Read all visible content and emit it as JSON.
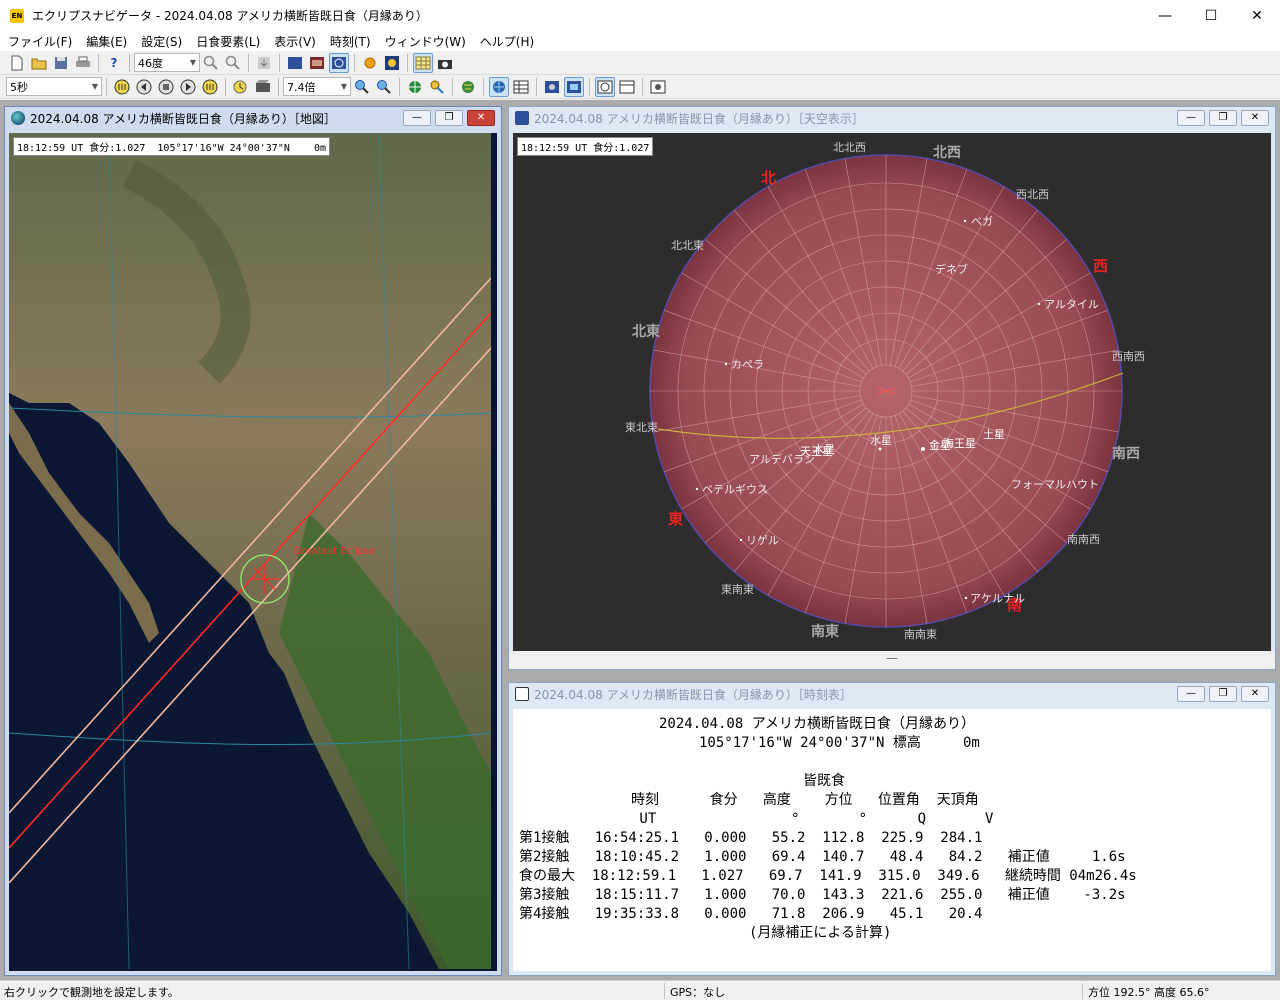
{
  "app": {
    "title": "エクリプスナビゲータ - 2024.04.08 アメリカ横断皆既日食（月縁あり）",
    "icon_label": "EN",
    "window_buttons": {
      "minimize": "—",
      "maximize": "☐",
      "close": "✕"
    }
  },
  "menu": [
    "ファイル(F)",
    "編集(E)",
    "設定(S)",
    "日食要素(L)",
    "表示(V)",
    "時刻(T)",
    "ウィンドウ(W)",
    "ヘルプ(H)"
  ],
  "toolbar1": {
    "angle_value": "46度"
  },
  "toolbar2": {
    "step_value": "5秒",
    "zoom_value": "7.4倍"
  },
  "map_window": {
    "title": "2024.04.08 アメリカ横断皆既日食（月縁あり）［地図］",
    "info": "18:12:59 UT 食分:1.027  105°17'16\"W 24°00'37\"N    0m",
    "greatest_label": "Greatest Eclipse"
  },
  "sky_window": {
    "title": "2024.04.08 アメリカ横断皆既日食（月縁あり）［天空表示］",
    "info": "18:12:59 UT 食分:1.027",
    "directions": [
      {
        "text": "北",
        "red": true
      },
      {
        "text": "北西",
        "red": false
      },
      {
        "text": "西",
        "red": true
      },
      {
        "text": "北東",
        "red": false
      },
      {
        "text": "東",
        "red": true
      },
      {
        "text": "南東",
        "red": false
      },
      {
        "text": "南",
        "red": true
      },
      {
        "text": "南西",
        "red": false
      }
    ],
    "minor_directions": [
      "北北西",
      "西北西",
      "北北東",
      "西南西",
      "東北東",
      "南南西",
      "東南東",
      "南南東"
    ],
    "stars": [
      "ベガ",
      "デネブ",
      "アルタイル",
      "カペラ",
      "アルデバラン",
      "ベテルギウス",
      "リゲル",
      "フォーマルハウト",
      "アケルナル"
    ],
    "planets": [
      "天王星",
      "木星",
      "水星",
      "金星",
      "海王星",
      "土星"
    ]
  },
  "table_window": {
    "title": "2024.04.08 アメリカ横断皆既日食（月縁あり）［時刻表］",
    "heading": "2024.04.08 アメリカ横断皆既日食（月縁あり）",
    "location": "105°17'16\"W 24°00'37\"N 標高     0m",
    "eclipse_type": "皆既食",
    "col_header1": "時刻      食分   高度    方位   位置角  天頂角",
    "col_header2": " UT                °       °      Q       V",
    "rows": [
      "第1接触   16:54:25.1   0.000   55.2  112.8  225.9  284.1",
      "第2接触   18:10:45.2   1.000   69.4  140.7   48.4   84.2   補正値     1.6s",
      "食の最大  18:12:59.1   1.027   69.7  141.9  315.0  349.6   継続時間 04m26.4s",
      "第3接触   18:15:11.7   1.000   70.0  143.3  221.6  255.0   補正値    -3.2s",
      "第4接触   19:35:33.8   0.000   71.8  206.9   45.1   20.4"
    ],
    "footer": "(月縁補正による計算)"
  },
  "status": {
    "hint": "右クリックで観測地を設定します。",
    "gps": "GPS：なし",
    "azimuth": "方位 192.5° 高度  65.6°"
  }
}
